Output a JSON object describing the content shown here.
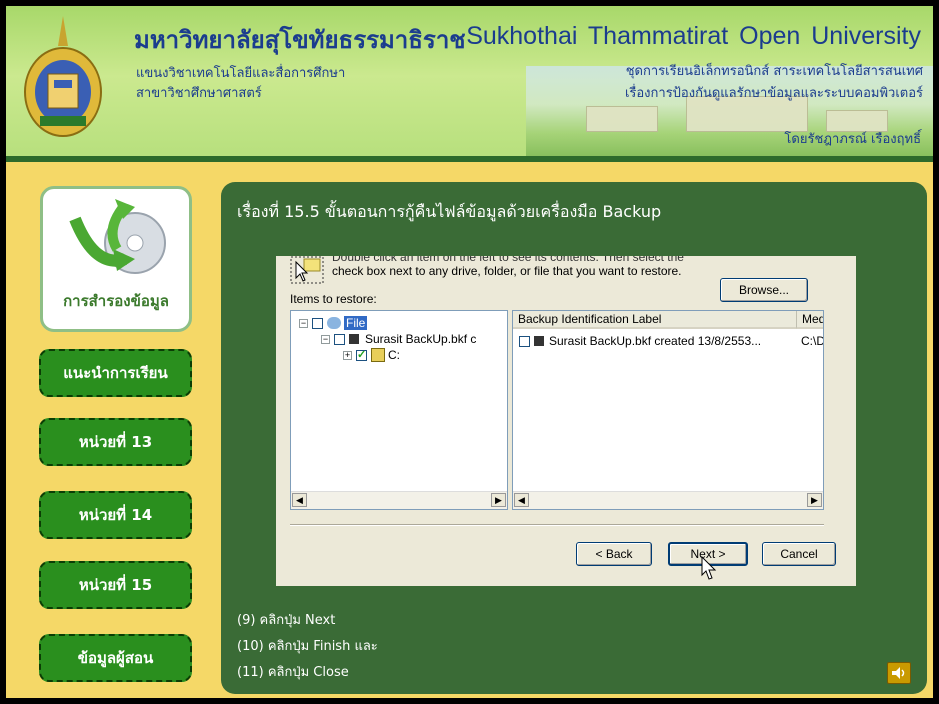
{
  "header": {
    "university_th": "มหาวิทยาลัยสุโขทัยธรรมาธิราช",
    "university_en": "Sukhothai Thammatirat Open University",
    "dept_line1": "แขนงวิชาเทคโนโลยีและสื่อการศึกษา",
    "dept_line2": "สาขาวิชาศึกษาศาสตร์",
    "series_line1": "ชุดการเรียนอิเล็กทรอนิกส์ สาระเทคโนโลยีสารสนเทศ",
    "series_line2": "เรื่องการป้องกันดูแลรักษาข้อมูลและระบบคอมพิวเตอร์",
    "author": "โดยรัชฎาภรณ์ เรืองฤทธิ์"
  },
  "sidebar": {
    "main_label": "การสำรองข้อมูล",
    "items": [
      {
        "label": "แนะนำการเรียน"
      },
      {
        "label": "หน่วยที่ 13"
      },
      {
        "label": "หน่วยที่ 14"
      },
      {
        "label": "หน่วยที่ 15"
      },
      {
        "label": "ข้อมูลผู้สอน"
      }
    ]
  },
  "panel": {
    "title": "เรื่องที่ 15.5 ขั้นตอนการกู้คืนไฟล์ข้อมูลด้วยเครื่องมือ Backup"
  },
  "dialog": {
    "instruction_line1": "Double click an item on the left to see its contents. Then select the",
    "instruction_line2": "check box next to any drive, folder, or file that you want to restore.",
    "items_label": "Items to restore:",
    "browse_label": "Browse...",
    "tree": [
      {
        "label": "File",
        "checked": false
      },
      {
        "label": "Surasit BackUp.bkf c",
        "checked": false
      },
      {
        "label": "C:",
        "checked": true
      }
    ],
    "columns": [
      "Backup Identification Label",
      "Med"
    ],
    "rows": [
      {
        "label": "Surasit BackUp.bkf created 13/8/2553...",
        "media": "C:\\D"
      }
    ],
    "back_label": "< Back",
    "next_label": "Next >",
    "cancel_label": "Cancel"
  },
  "steps": [
    "(9) คลิกปุ่ม Next",
    "(10) คลิกปุ่ม Finish และ",
    "(11) คลิกปุ่ม Close"
  ],
  "colors": {
    "header_green": "#b6df7c",
    "background_yellow": "#f5d867",
    "panel_green": "#3a6b36",
    "nav_green": "#2a8f1e",
    "title_blue": "#1b3c8e"
  },
  "icons": [
    "university-logo",
    "restore-icon",
    "dialog-icon",
    "speaker-icon",
    "mouse-cursor-icon"
  ]
}
